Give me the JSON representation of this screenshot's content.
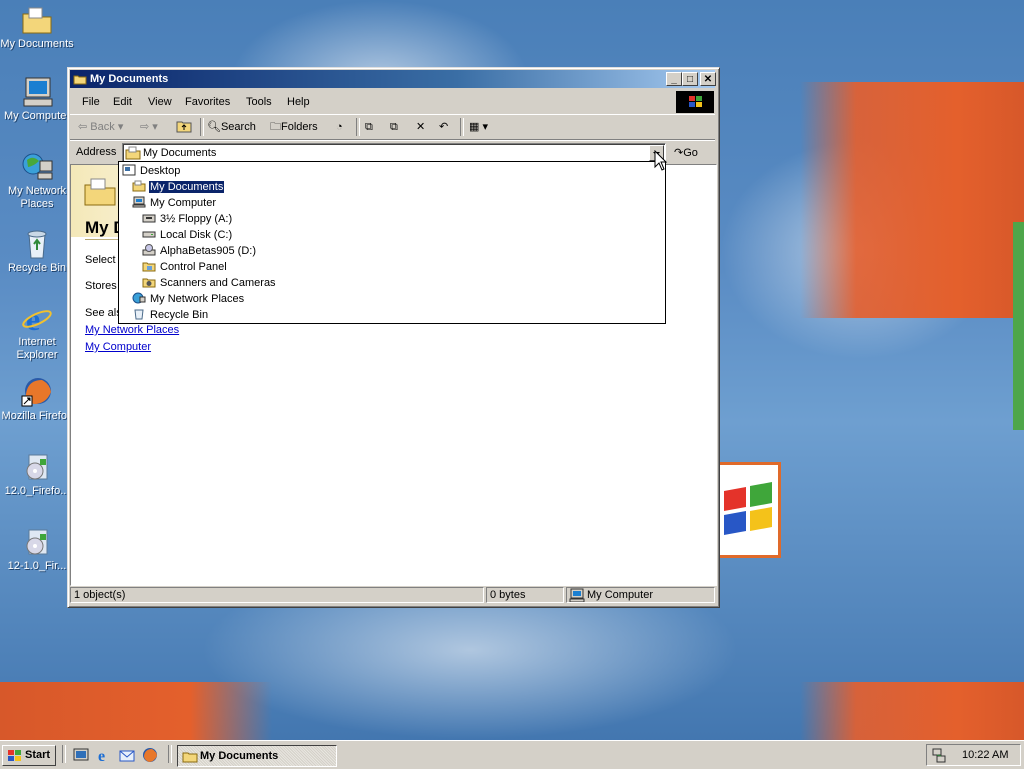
{
  "desktop": {
    "icons": [
      {
        "label": "My Documents",
        "icon": "my-documents-folder-icon"
      },
      {
        "label": "My Computer",
        "icon": "my-computer-icon"
      },
      {
        "label": "My Network\nPlaces",
        "icon": "network-places-icon"
      },
      {
        "label": "Recycle Bin",
        "icon": "recycle-bin-icon"
      },
      {
        "label": "Internet\nExplorer",
        "icon": "internet-explorer-icon"
      },
      {
        "label": "Mozilla Firefox",
        "icon": "firefox-shortcut-icon"
      },
      {
        "label": "12.0_Firefo...",
        "icon": "installer-icon"
      },
      {
        "label": "12-1.0_Fir...",
        "icon": "installer-icon"
      }
    ]
  },
  "window": {
    "title": "My Documents",
    "menu": [
      "File",
      "Edit",
      "View",
      "Favorites",
      "Tools",
      "Help"
    ],
    "toolbar": {
      "back": "Back",
      "search": "Search",
      "folders": "Folders"
    },
    "address": {
      "label": "Address",
      "value": "My Documents",
      "go": "Go"
    },
    "leftpane": {
      "title": "My D",
      "select_text": "Select a",
      "stores_text": "Stores",
      "see_also": "See als",
      "links": [
        "My Network Places",
        "My Computer"
      ]
    },
    "status": {
      "objects": "1 object(s)",
      "size": "0 bytes",
      "zone": "My Computer"
    }
  },
  "address_dropdown": {
    "items": [
      {
        "label": "Desktop",
        "level": 0,
        "icon": "desktop-icon",
        "selected": false
      },
      {
        "label": "My Documents",
        "level": 1,
        "icon": "my-documents-folder-icon",
        "selected": true
      },
      {
        "label": "My Computer",
        "level": 1,
        "icon": "my-computer-icon",
        "selected": false
      },
      {
        "label": "3½ Floppy (A:)",
        "level": 2,
        "icon": "floppy-drive-icon",
        "selected": false
      },
      {
        "label": "Local Disk (C:)",
        "level": 2,
        "icon": "hard-disk-icon",
        "selected": false
      },
      {
        "label": "AlphaBetas905 (D:)",
        "level": 2,
        "icon": "cd-drive-icon",
        "selected": false
      },
      {
        "label": "Control Panel",
        "level": 2,
        "icon": "control-panel-icon",
        "selected": false
      },
      {
        "label": "Scanners and Cameras",
        "level": 2,
        "icon": "scanner-camera-icon",
        "selected": false
      },
      {
        "label": "My Network Places",
        "level": 1,
        "icon": "network-places-icon",
        "selected": false
      },
      {
        "label": "Recycle Bin",
        "level": 1,
        "icon": "recycle-bin-icon",
        "selected": false
      }
    ]
  },
  "taskbar": {
    "start": "Start",
    "task": "My Documents",
    "clock": "10:22 AM"
  }
}
